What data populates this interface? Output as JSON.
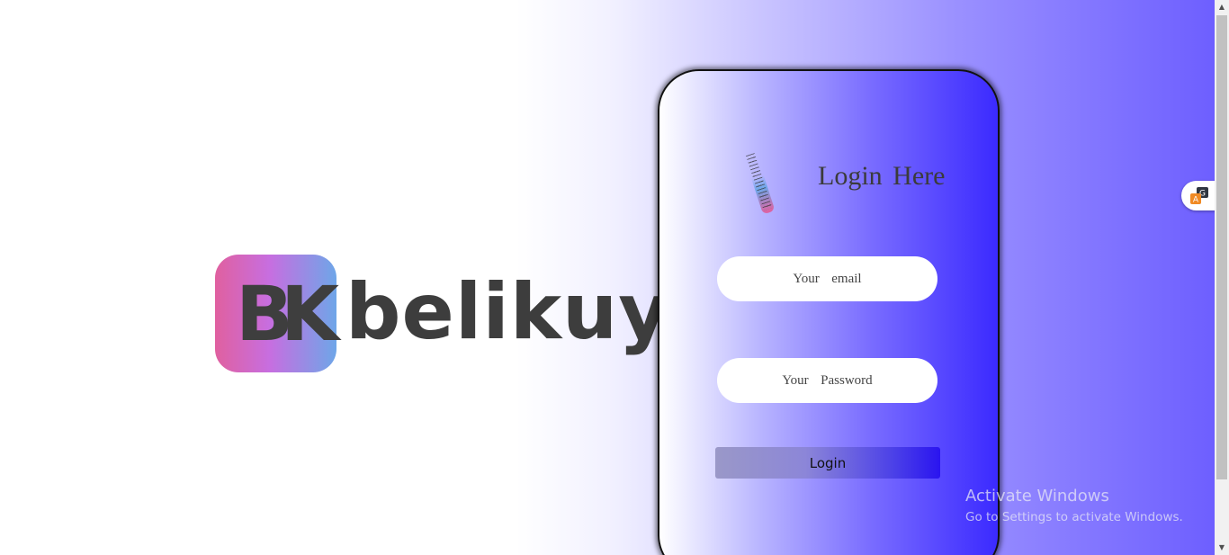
{
  "brand": {
    "logo_letters": "BK",
    "name": "belikuy",
    "logo_colors": [
      "#e0609f",
      "#c76ee0",
      "#6ea6e8"
    ]
  },
  "login": {
    "title": "Login Here",
    "email_placeholder": "Your  email",
    "password_placeholder": "Your  Password",
    "button_label": "Login",
    "card_gradient": [
      "#ffffff",
      "#7a6dff",
      "#3b2aff"
    ]
  },
  "watermark": {
    "title": "Activate Windows",
    "subtitle": "Go to Settings to activate Windows."
  },
  "extension": {
    "icon": "translate-extension-icon"
  },
  "scrollbar": {
    "up_arrow": "▲",
    "down_arrow": "▼"
  }
}
